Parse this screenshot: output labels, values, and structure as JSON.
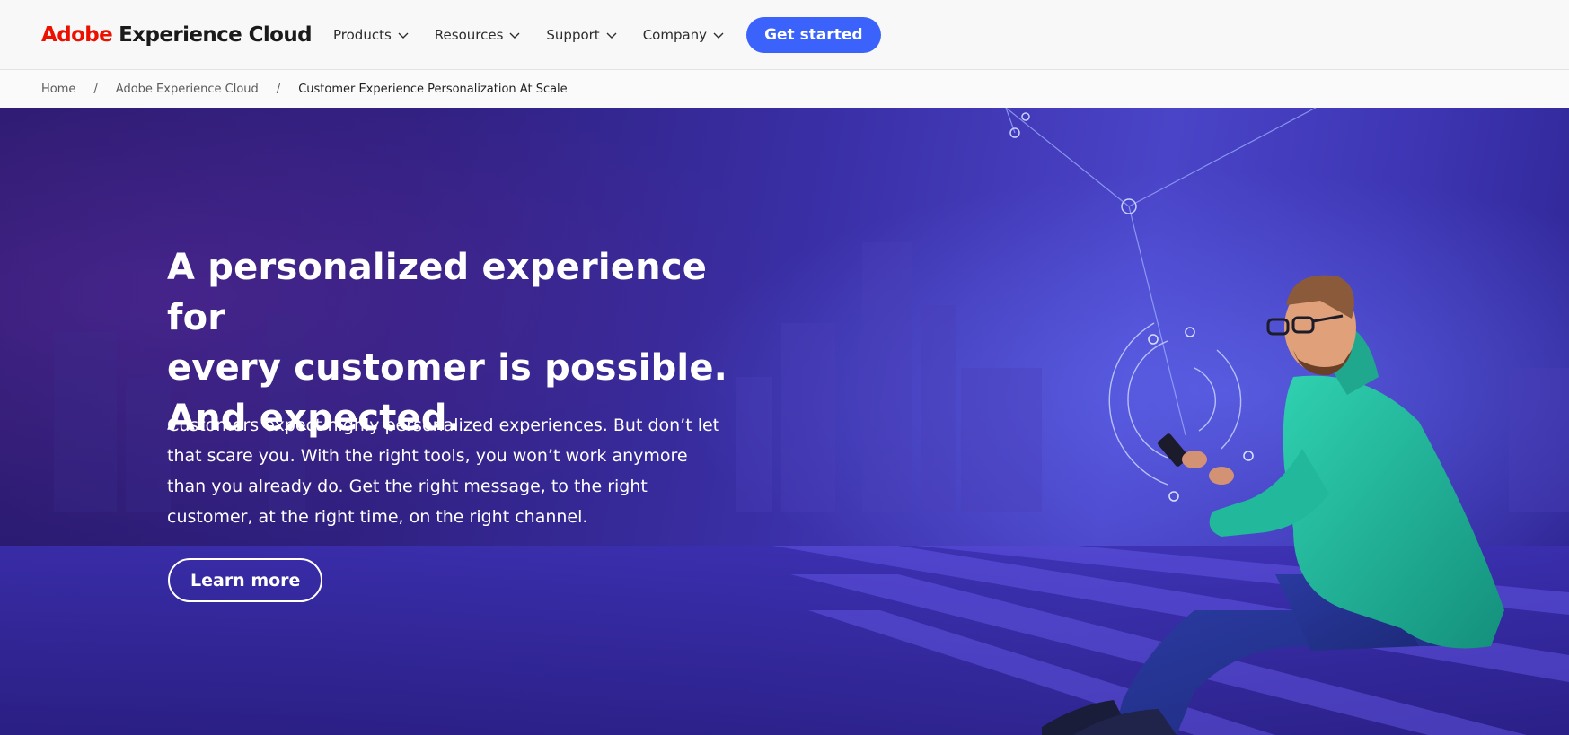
{
  "header": {
    "logo_brand": "Adobe",
    "logo_product": "Experience Cloud",
    "nav": [
      {
        "label": "Products"
      },
      {
        "label": "Resources"
      },
      {
        "label": "Support"
      },
      {
        "label": "Company"
      }
    ],
    "cta_label": "Get started"
  },
  "breadcrumb": {
    "items": [
      "Home",
      "Adobe Experience Cloud",
      "Customer Experience Personalization At Scale"
    ],
    "separator": "/"
  },
  "hero": {
    "title_line1": "A personalized experience for",
    "title_line2": "every customer is possible.",
    "title_line3": "And expected.",
    "body_line1": "Customers expect highly personalized experiences. But don’t let",
    "body_line2": "that scare you. With the right tools, you won’t work anymore",
    "body_line3": "than you already do. Get the right message, to the right",
    "body_line4": "customer, at the right time, on the right channel.",
    "button_label": "Learn more"
  },
  "colors": {
    "brand_red": "#eb1000",
    "cta_blue": "#3b63fb",
    "hero_purple": "#3a2fa6",
    "jacket_teal": "#20b59a"
  },
  "icons": [
    "chevron-down-icon",
    "network-graphic",
    "person-illustration"
  ]
}
